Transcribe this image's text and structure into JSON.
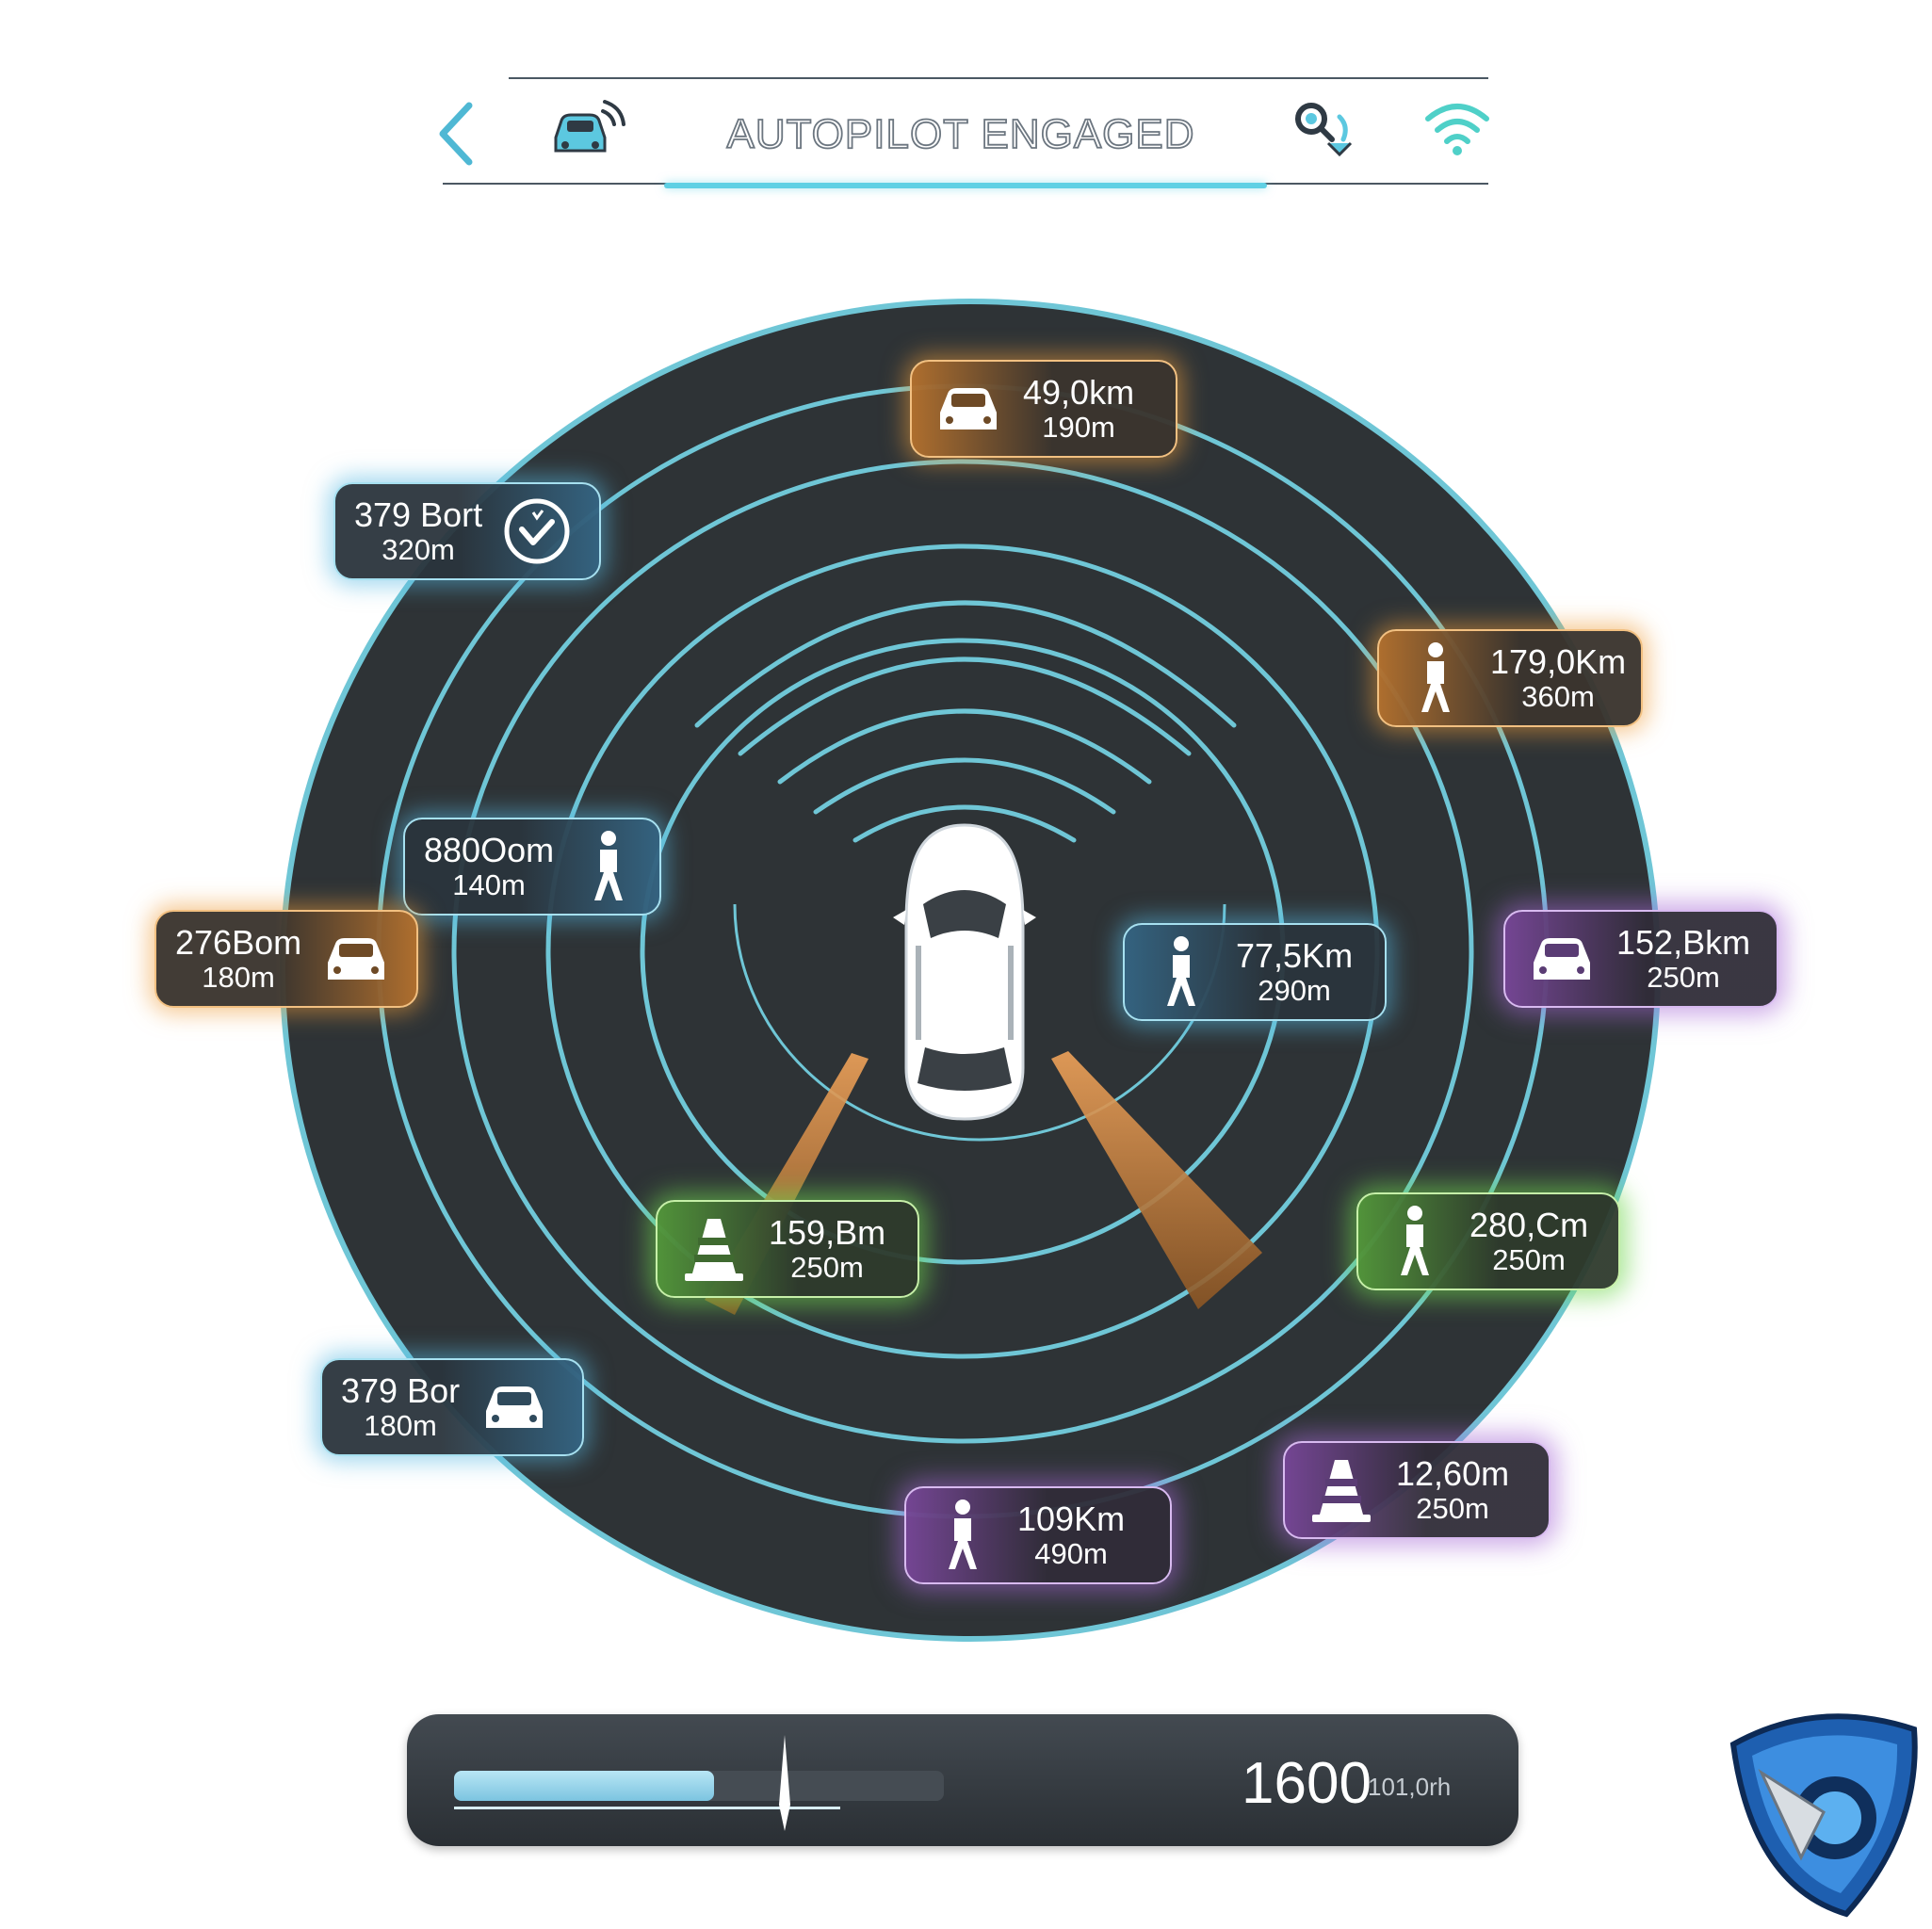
{
  "header": {
    "title": "AUTOPILOT ENGAGED",
    "back_icon": "chevron-left-icon",
    "car_icon": "car-signal-icon",
    "sensor_icon": "sensor-search-icon",
    "wifi_icon": "wifi-icon"
  },
  "detections": [
    {
      "id": "vehicle-north",
      "type": "vehicle",
      "icon": "car-icon",
      "color": "orange",
      "distance": "49,0km",
      "range": "190m"
    },
    {
      "id": "status-nw",
      "type": "status",
      "icon": "check-badge-icon",
      "color": "blue",
      "distance": "379 Bort",
      "range": "320m"
    },
    {
      "id": "pedestrian-ne",
      "type": "pedestrian",
      "icon": "pedestrian-icon",
      "color": "orange",
      "distance": "179,0Km",
      "range": "360m"
    },
    {
      "id": "pedestrian-left-inner",
      "type": "pedestrian",
      "icon": "pedestrian-icon",
      "color": "blue",
      "distance": "880Oom",
      "range": "140m"
    },
    {
      "id": "vehicle-west",
      "type": "vehicle",
      "icon": "car-icon",
      "color": "orange",
      "distance": "276Bom",
      "range": "180m"
    },
    {
      "id": "pedestrian-right-inner",
      "type": "pedestrian",
      "icon": "pedestrian-icon",
      "color": "blue",
      "distance": "77,5Km",
      "range": "290m"
    },
    {
      "id": "vehicle-east",
      "type": "vehicle",
      "icon": "car-icon",
      "color": "purple",
      "distance": "152,Bkm",
      "range": "250m"
    },
    {
      "id": "cone-rear-left",
      "type": "cone",
      "icon": "traffic-cone-icon",
      "color": "green",
      "distance": "159,Bm",
      "range": "250m"
    },
    {
      "id": "pedestrian-se",
      "type": "pedestrian",
      "icon": "pedestrian-icon",
      "color": "green",
      "distance": "280,Cm",
      "range": "250m"
    },
    {
      "id": "vehicle-sw",
      "type": "vehicle",
      "icon": "car-icon",
      "color": "blue",
      "distance": "379 Bor",
      "range": "180m"
    },
    {
      "id": "cone-south-east",
      "type": "cone",
      "icon": "traffic-cone-icon",
      "color": "purple",
      "distance": "12,60m",
      "range": "250m"
    },
    {
      "id": "pedestrian-south",
      "type": "pedestrian",
      "icon": "pedestrian-icon",
      "color": "purple",
      "distance": "109Km",
      "range": "490m"
    }
  ],
  "progress": {
    "fraction": 0.53,
    "readout": "1600",
    "unit": "101,0rh"
  },
  "logo": {
    "icon": "shield-logo-icon"
  },
  "colors": {
    "accent": "#5fd0e4",
    "radar_bg": "#2e3336",
    "ring": "#6fc6d6",
    "orange": "#ee9c3a",
    "blue": "#56b8e2",
    "green": "#70d64e",
    "purple": "#a668d6"
  }
}
